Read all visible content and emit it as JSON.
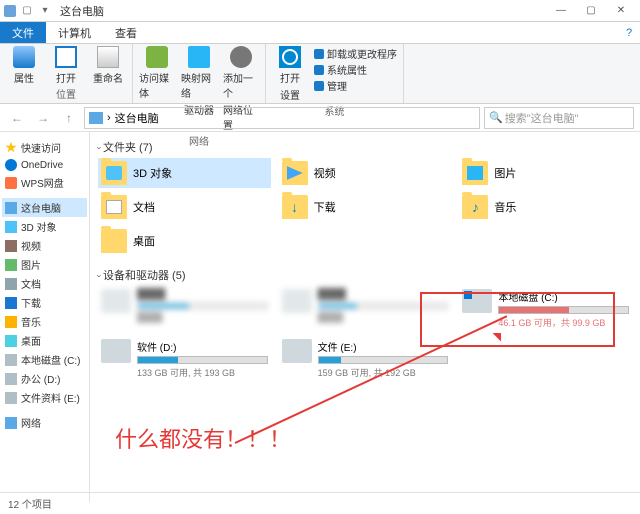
{
  "window": {
    "title": "这台电脑"
  },
  "tabs": {
    "file": "文件",
    "computer": "计算机",
    "view": "查看"
  },
  "ribbon": {
    "props": "属性",
    "open": "打开",
    "rename": "重命名",
    "media": "访问媒体",
    "mapnet1": "映射网络",
    "mapnet2": "驱动器",
    "addnet1": "添加一个",
    "addnet2": "网络位置",
    "opensettings1": "打开",
    "opensettings2": "设置",
    "uninstall": "卸载或更改程序",
    "sysprops": "系统属性",
    "manage": "管理",
    "g_location": "位置",
    "g_network": "网络",
    "g_system": "系统"
  },
  "addr": {
    "this_pc": "这台电脑"
  },
  "search": {
    "placeholder": "搜索\"这台电脑\""
  },
  "nav": {
    "quick": "快速访问",
    "onedrive": "OneDrive",
    "wps": "WPS网盘",
    "thispc": "这台电脑",
    "obj3d": "3D 对象",
    "videos": "视频",
    "pictures": "图片",
    "docs": "文档",
    "downloads": "下载",
    "music": "音乐",
    "desktop": "桌面",
    "localc": "本地磁盘 (C:)",
    "officed": "办公 (D:)",
    "filese": "文件资料 (E:)",
    "network": "网络"
  },
  "folders_h": "文件夹 (7)",
  "folders": {
    "obj3d": "3D 对象",
    "videos": "视频",
    "pictures": "图片",
    "docs": "文档",
    "downloads": "下载",
    "music": "音乐",
    "desktop": "桌面"
  },
  "drives_h": "设备和驱动器 (5)",
  "drives": {
    "c_name": "本地磁盘 (C:)",
    "c_sub": "46.1 GB 可用，共 99.9 GB",
    "d_name": "软件 (D:)",
    "d_sub": "133 GB 可用, 共 193 GB",
    "e_name": "文件 (E:)",
    "e_sub": "159 GB 可用, 共 192 GB"
  },
  "annotation": "什么都没有！！！",
  "status": "12 个项目"
}
